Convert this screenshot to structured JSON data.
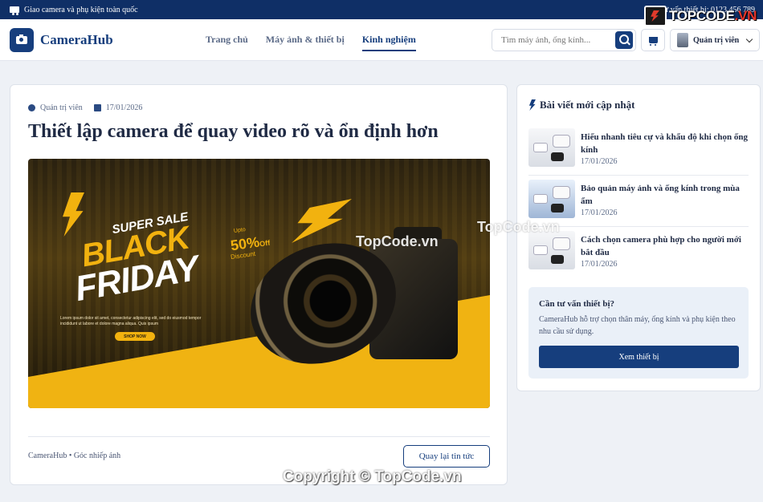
{
  "topbar": {
    "shipping_text": "Giao camera và phụ kiện toàn quốc",
    "hotline_text": "Tư vấn thiết bị: 0123 456 789"
  },
  "brand_badge": {
    "text_main": "TOPCODE",
    "text_suffix": ".VN"
  },
  "header": {
    "logo_text": "CameraHub",
    "nav": [
      {
        "label": "Trang chủ",
        "active": false
      },
      {
        "label": "Máy ảnh & thiết bị",
        "active": false
      },
      {
        "label": "Kinh nghiệm",
        "active": true
      }
    ],
    "search_placeholder": "Tìm máy ảnh, ống kính...",
    "user_label": "Quản trị viên"
  },
  "article": {
    "author": "Quản trị viên",
    "date": "17/01/2026",
    "title": "Thiết lập camera để quay video rõ và ổn định hơn",
    "banner": {
      "super_sale": "SUPER SALE",
      "black": "BLACK",
      "friday": "FRIDAY",
      "upto": "Upto",
      "percent": "50%",
      "off": "Off",
      "discount": "Discount",
      "lorem": "Lorem ipsum dolor sit amet, consectetur adipiscing elit, sed do eiusmod tempor incididunt ut labore et dolore magna aliqua. Quis ipsum",
      "shop_now": "SHOP NOW"
    },
    "footer_text": "CameraHub • Góc nhiếp ảnh",
    "back_button": "Quay lại tin tức"
  },
  "sidebar": {
    "title": "Bài viết mới cập nhật",
    "posts": [
      {
        "title": "Hiểu nhanh tiêu cự và khẩu độ khi chọn ống kính",
        "date": "17/01/2026"
      },
      {
        "title": "Bảo quản máy ảnh và ống kính trong mùa ẩm",
        "date": "17/01/2026"
      },
      {
        "title": "Cách chọn camera phù hợp cho người mới bắt đầu",
        "date": "17/01/2026"
      }
    ],
    "consult": {
      "title": "Cần tư vấn thiết bị?",
      "desc": "CameraHub hỗ trợ chọn thân máy, ống kính và phụ kiện theo nhu cầu sử dụng.",
      "button": "Xem thiết bị"
    }
  },
  "watermarks": {
    "w1": "TopCode.vn",
    "w2": "TopCode.vn",
    "w3": "Copyright © TopCode.vn"
  },
  "colors": {
    "primary": "#163e7d",
    "topbar": "#0f2f66",
    "accent": "#f2b20f"
  }
}
